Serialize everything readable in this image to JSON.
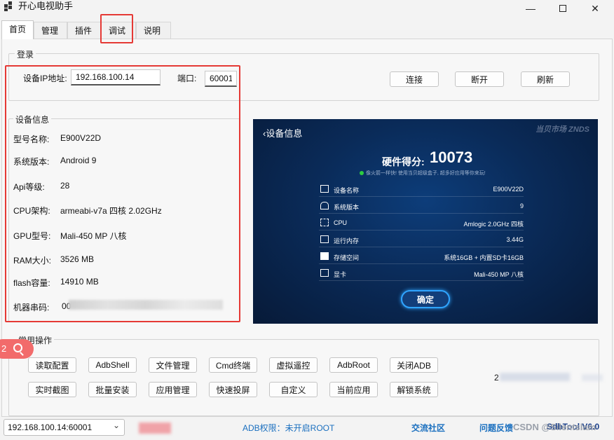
{
  "window": {
    "title": "开心电视助手"
  },
  "tabs": [
    "首页",
    "管理",
    "插件",
    "调试",
    "说明"
  ],
  "login": {
    "group_title": "登录",
    "ip_label": "设备IP地址:",
    "ip_value": "192.168.100.14",
    "port_label": "端口:",
    "port_value": "60001",
    "connect_label": "连接",
    "disconnect_label": "断开",
    "refresh_label": "刷新"
  },
  "device_info": {
    "group_title": "设备信息",
    "rows": [
      {
        "label": "型号名称:",
        "value": "E900V22D"
      },
      {
        "label": "系统版本:",
        "value": "Android 9"
      },
      {
        "label": "Api等级:",
        "value": "28"
      },
      {
        "label": "CPU架构:",
        "value": "armeabi-v7a 四核 2.02GHz"
      },
      {
        "label": "GPU型号:",
        "value": "Mali-450 MP 八核"
      },
      {
        "label": "RAM大小:",
        "value": "3526 MB"
      },
      {
        "label": "flash容量:",
        "value": "14910 MB"
      },
      {
        "label": "机器串码:",
        "value": "00"
      }
    ]
  },
  "tv_screenshot": {
    "back_title": "‹设备信息",
    "brand": "当贝市场  ZNDS",
    "score_label": "硬件得分:",
    "score_value": "10073",
    "subtitle": "像火箭一样快! 使用当贝超级盒子, 超多好应用等你来玩!",
    "rows": [
      {
        "key": "设备名称",
        "value": "E900V22D"
      },
      {
        "key": "系统版本",
        "value": "9"
      },
      {
        "key": "CPU",
        "value": "Amlogic 2.0GHz 四核"
      },
      {
        "key": "运行内存",
        "value": "3.44G"
      },
      {
        "key": "存储空间",
        "value": "系统16GB + 内置SD卡16GB"
      },
      {
        "key": "显卡",
        "value": "Mali-450 MP 八核"
      }
    ],
    "ok_label": "确定"
  },
  "common_ops": {
    "group_title": "常用操作",
    "row1": [
      "读取配置",
      "AdbShell",
      "文件管理",
      "Cmd终端",
      "虚拟遥控",
      "AdbRoot",
      "关闭ADB"
    ],
    "row2": [
      "实时截图",
      "批量安装",
      "应用管理",
      "快速投屏",
      "自定义",
      "当前应用",
      "解锁系统"
    ],
    "side_text": "2"
  },
  "status": {
    "device_select": "192.168.100.14:60001",
    "adb_permission": "ADB权限：未开启ROOT",
    "community": "交流社区",
    "feedback": "问题反馈",
    "version": "SdbTool V6.0",
    "watermark": "CSDN @Silentslam"
  },
  "overlay": {
    "search_badge": "2"
  }
}
